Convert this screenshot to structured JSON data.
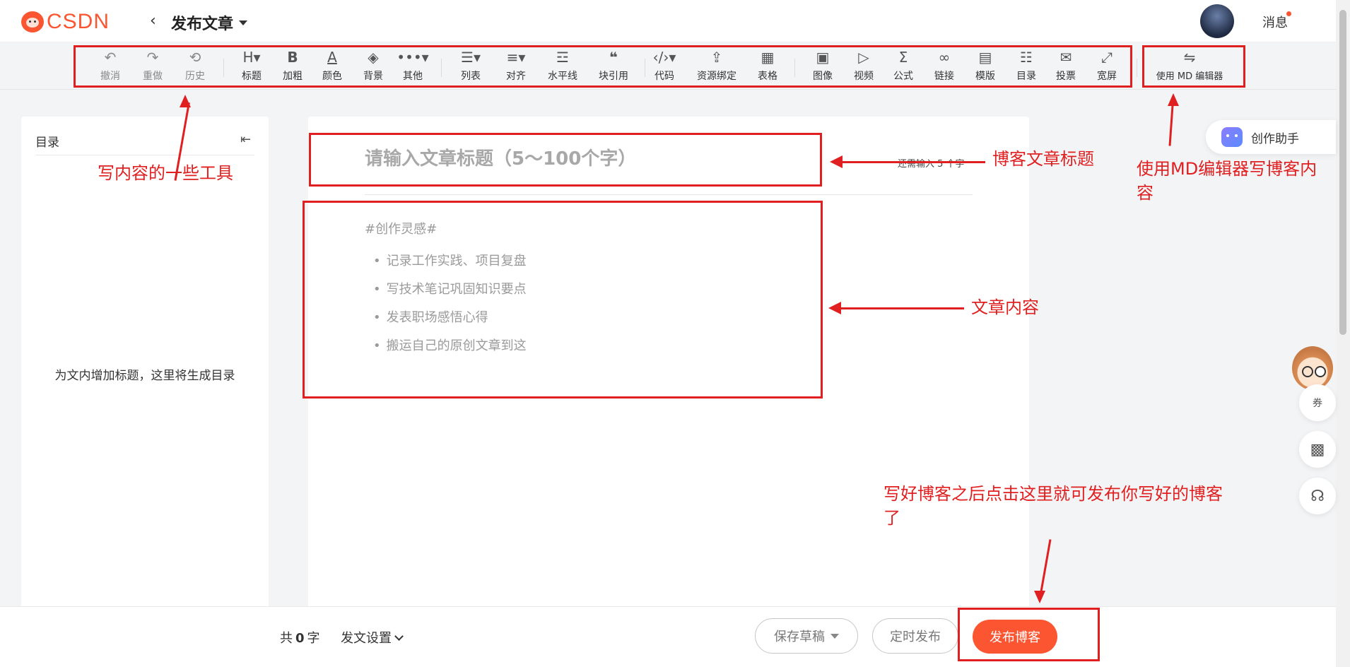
{
  "header": {
    "logo_text": "CSDN",
    "back_icon": "chevron-left-icon",
    "title": "发布文章",
    "messages_label": "消息"
  },
  "toolbar": {
    "undo": "撤消",
    "redo": "重做",
    "history": "历史",
    "heading": "标题",
    "bold": "加粗",
    "color": "颜色",
    "background": "背景",
    "more": "其他",
    "list": "列表",
    "align": "对齐",
    "hr": "水平线",
    "quote": "块引用",
    "code": "代码",
    "resource": "资源绑定",
    "table": "表格",
    "image": "图像",
    "video": "视频",
    "formula": "公式",
    "link": "链接",
    "template": "模版",
    "toc": "目录",
    "vote": "投票",
    "wide": "宽屏",
    "md_editor": "使用 MD 编辑器"
  },
  "sidebar": {
    "title": "目录",
    "empty_hint": "为文内增加标题，这里将生成目录"
  },
  "editor": {
    "title_placeholder": "请输入文章标题（5～100个字）",
    "title_hint": "还需输入 5 个字",
    "content_tag": "#创作灵感#",
    "content_items": [
      "记录工作实践、项目复盘",
      "写技术笔记巩固知识要点",
      "发表职场感悟心得",
      "搬运自己的原创文章到这"
    ]
  },
  "right_panel": {
    "assistant_label": "创作助手",
    "coupon_label": "券"
  },
  "bottom": {
    "count_prefix": "共",
    "count_value": "0",
    "count_suffix": "字",
    "settings_label": "发文设置",
    "save_draft": "保存草稿",
    "schedule": "定时发布",
    "publish": "发布博客"
  },
  "annotations": {
    "tools": "写内容的一些工具",
    "title": "博客文章标题",
    "md": "使用MD编辑器写博客内容",
    "content": "文章内容",
    "publish": "写好博客之后点击这里就可发布你写好的博客了"
  },
  "colors": {
    "brand": "#fc5531",
    "annotation": "#e02020"
  }
}
